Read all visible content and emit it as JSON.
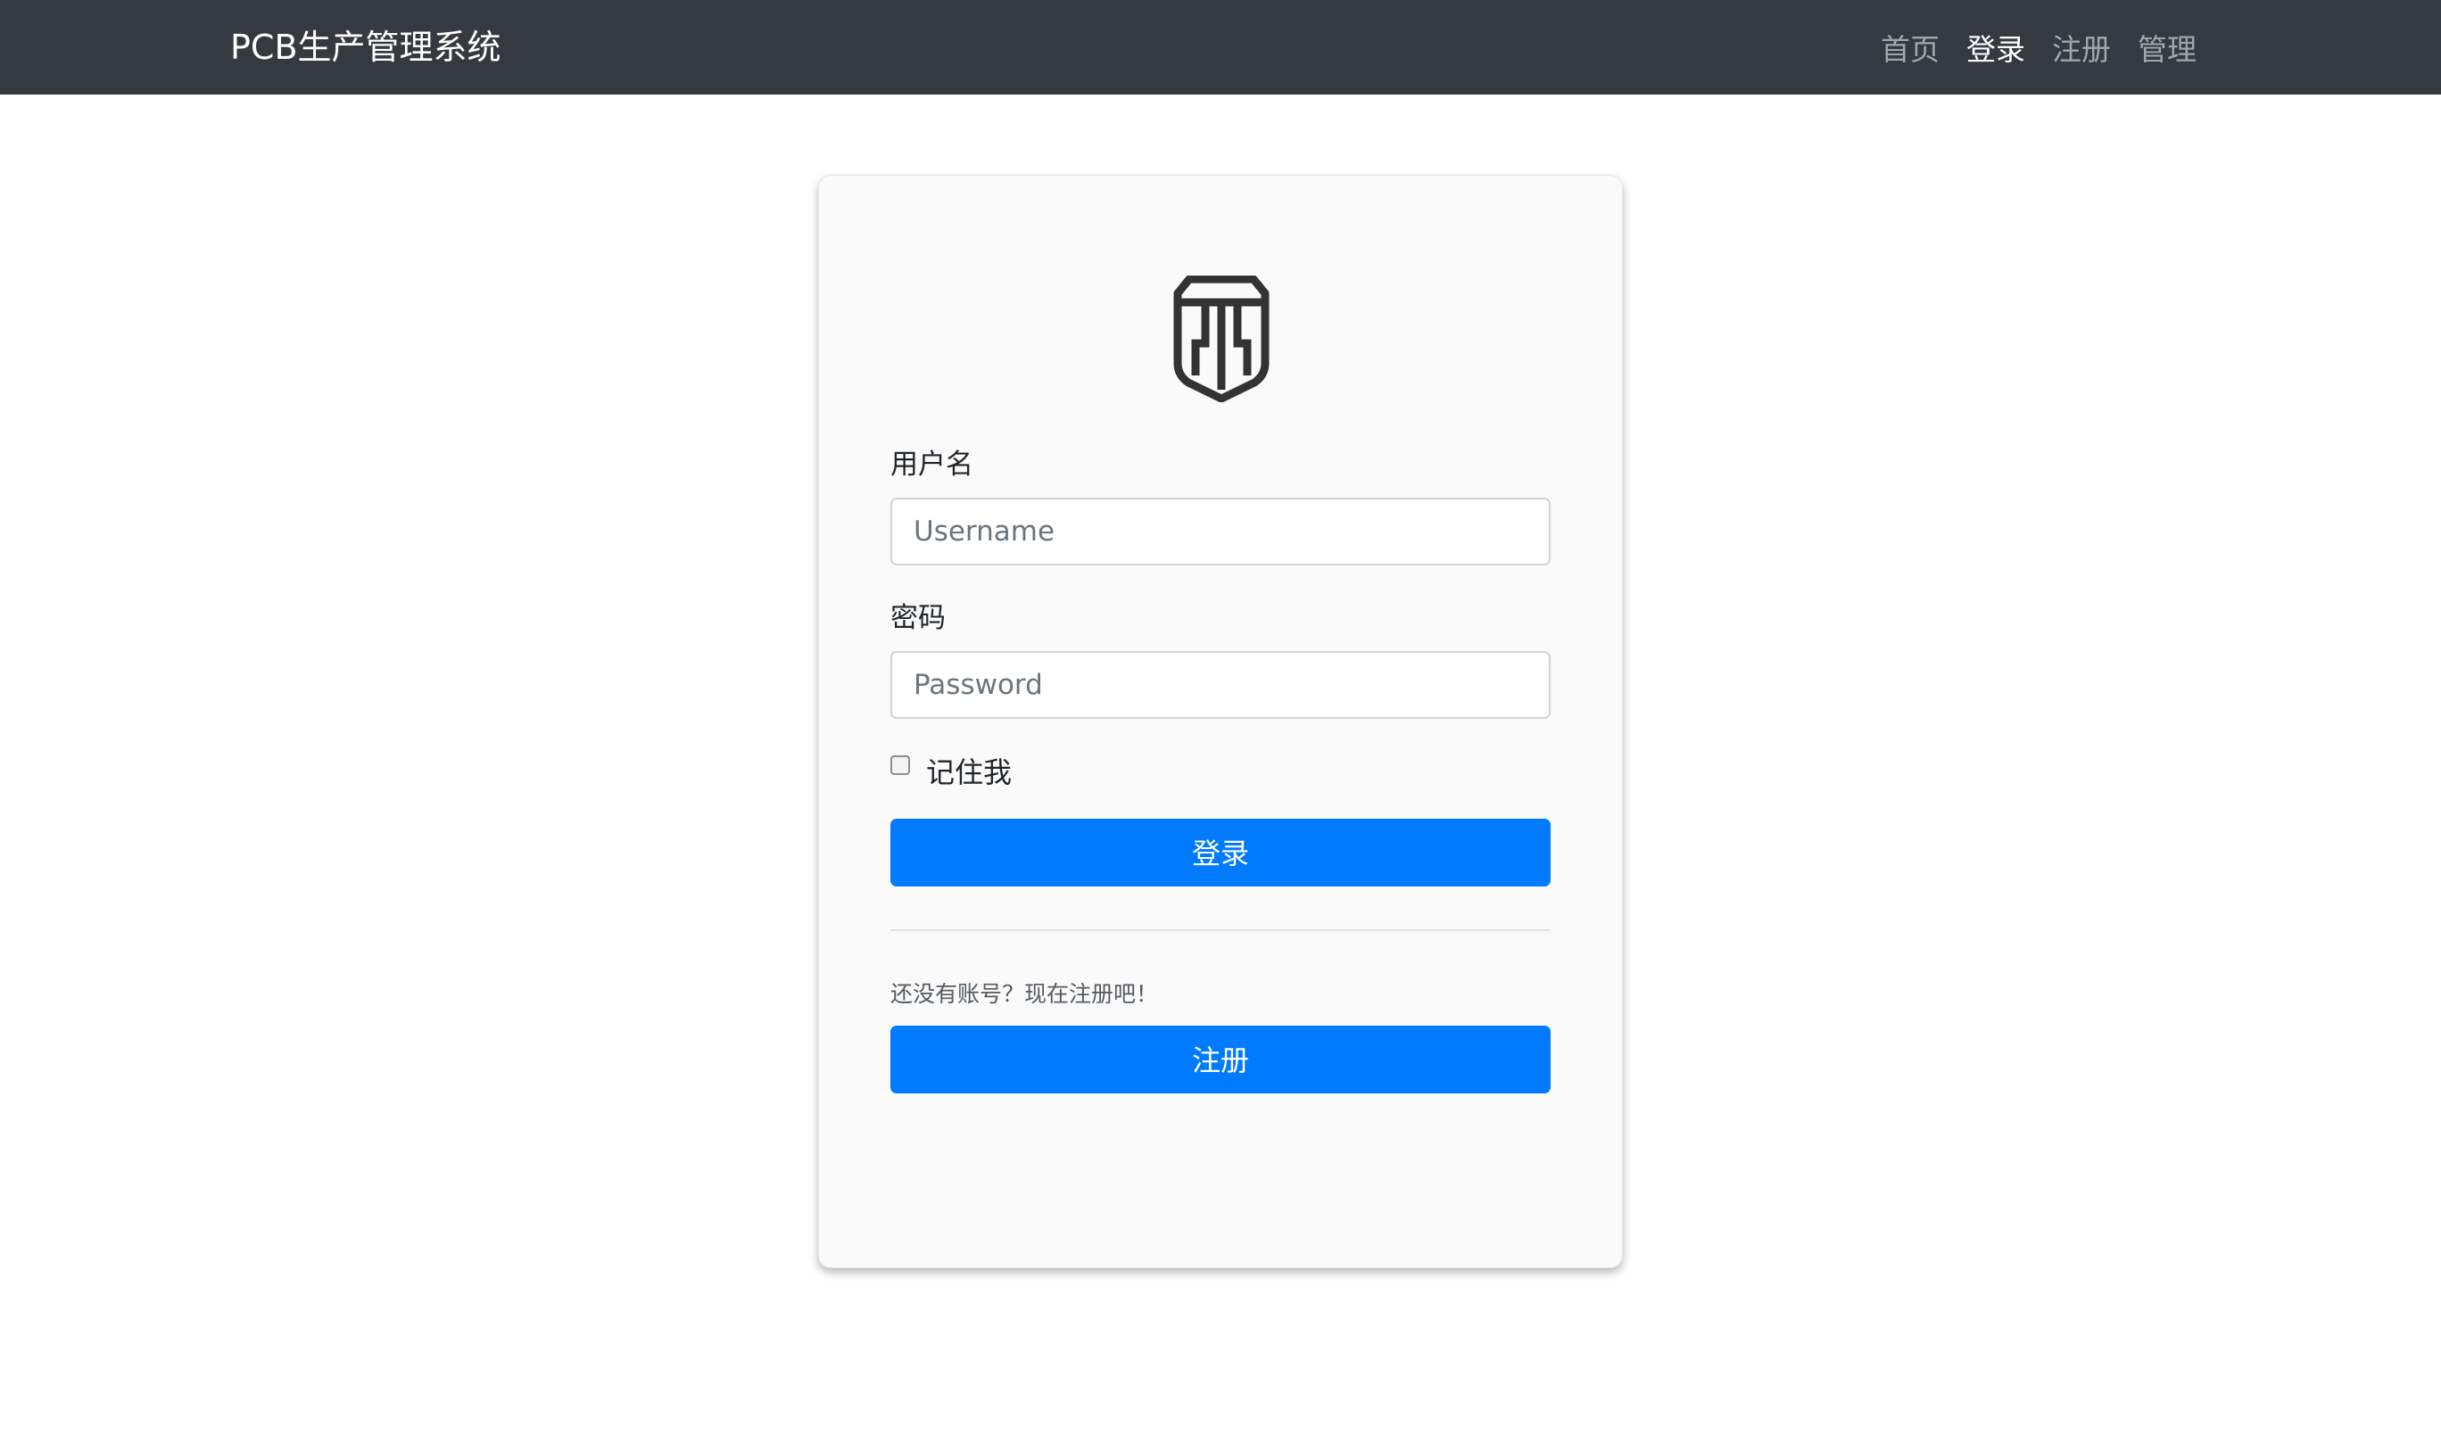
{
  "navbar": {
    "brand": "PCB生产管理系统",
    "links": [
      {
        "label": "首页"
      },
      {
        "label": "登录"
      },
      {
        "label": "注册"
      },
      {
        "label": "管理"
      }
    ]
  },
  "login_form": {
    "logo_icon": "shield-logo-icon",
    "username_label": "用户名",
    "username_placeholder": "Username",
    "username_value": "",
    "password_label": "密码",
    "password_placeholder": "Password",
    "password_value": "",
    "remember_label": "记住我",
    "remember_checked": false,
    "login_button": "登录",
    "register_hint": "还没有账号？现在注册吧！",
    "register_button": "注册"
  },
  "colors": {
    "navbar_bg": "#343a40",
    "primary": "#007bff",
    "card_bg": "#fafafa"
  }
}
